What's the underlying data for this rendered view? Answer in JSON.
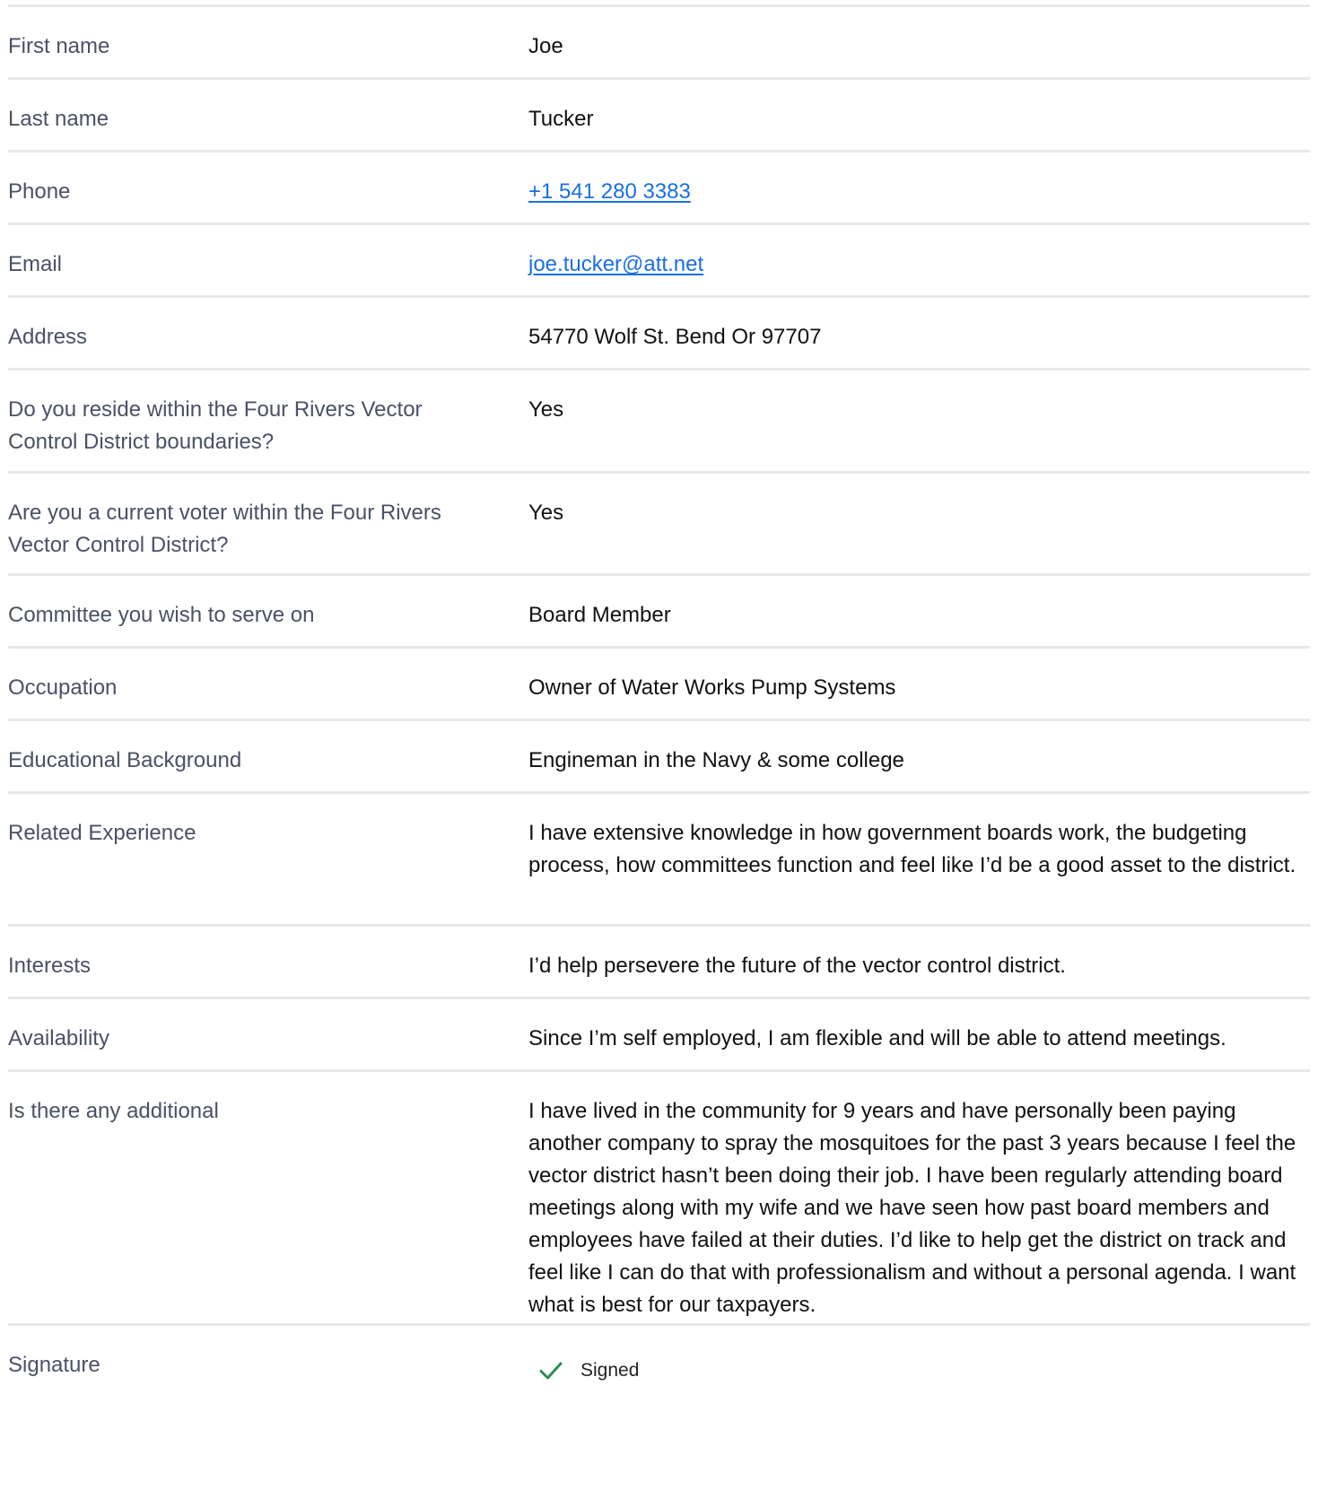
{
  "fields": [
    {
      "label": "First name",
      "value": "Joe"
    },
    {
      "label": "Last name",
      "value": "Tucker"
    },
    {
      "label": "Phone",
      "value": "+1 541 280 3383",
      "link": true
    },
    {
      "label": "Email",
      "value": "joe.tucker@att.net",
      "link": true
    },
    {
      "label": "Address",
      "value": "54770 Wolf St. Bend Or 97707"
    },
    {
      "label": "Do you reside within the Four Rivers Vector Control District boundaries?",
      "value": "Yes"
    },
    {
      "label": "Are you a current voter within the Four Rivers Vector Control District?",
      "value": "Yes"
    },
    {
      "label": "Committee you wish to serve on",
      "value": "Board Member"
    },
    {
      "label": "Occupation",
      "value": "Owner of Water Works Pump Systems"
    },
    {
      "label": "Educational Background",
      "value": "Engineman in the Navy & some college"
    },
    {
      "label": "Related Experience",
      "value": "I have extensive knowledge in how government boards work, the budgeting process, how committees function and feel like I’d be a good asset to the district."
    },
    {
      "label": "Interests",
      "value": "I’d help persevere the future of the vector control district."
    },
    {
      "label": "Availability",
      "value": "Since I’m self employed, I am flexible and will be able to attend meetings."
    },
    {
      "label": "Is there any additional",
      "value": "I have lived in the community for 9 years and have personally been paying another company to spray the mosquitoes for the past 3 years because I feel the vector district hasn’t been doing their job. I have been regularly attending board meetings along with my wife and we have seen how past board members and employees have failed at their duties. I’d like to help get the district on track and feel like I can do that with professionalism and without a personal agenda. I want what is best for our taxpayers."
    }
  ],
  "signature": {
    "label": "Signature",
    "status": "Signed",
    "icon": "checkmark-icon",
    "icon_color": "#2e8b57"
  },
  "colors": {
    "label_text": "#4a5166",
    "link": "#1a6fe0",
    "divider": "#e8e8e8"
  }
}
